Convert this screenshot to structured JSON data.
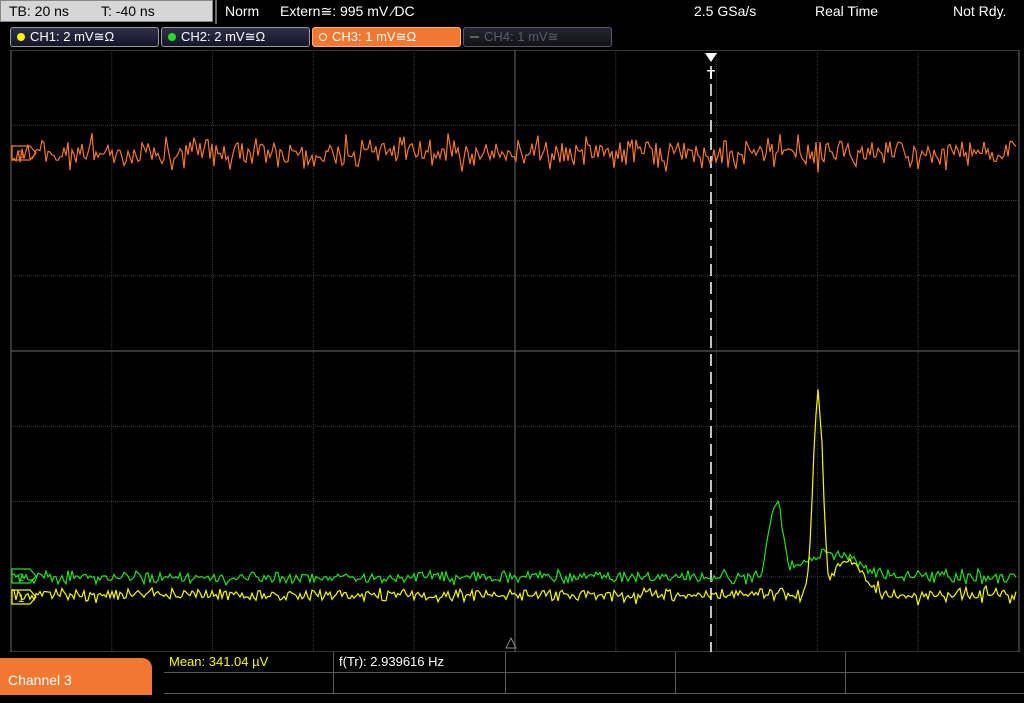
{
  "top": {
    "timebase": "TB: 20 ns",
    "trigger_time": "T: -40 ns",
    "mode": "Norm",
    "trigger_source": "Extern≅: 995 mV ⁄DC",
    "sample_rate": "2.5 GSa/s",
    "acq_mode": "Real Time",
    "status": "Not Rdy."
  },
  "channels": [
    {
      "label": "CH1: 2 mV≅Ω",
      "color": "#f7f700",
      "state": "on"
    },
    {
      "label": "CH2: 2 mV≅Ω",
      "color": "#22e022",
      "state": "on"
    },
    {
      "label": "CH3: 1 mV≅Ω",
      "color": "#f07830",
      "state": "active"
    },
    {
      "label": "CH4: 1 mV≅",
      "color": "#5d5d66",
      "state": "off"
    }
  ],
  "markers": {
    "trigger": "T",
    "ch3": "3",
    "ch2": "2",
    "ch1": "1"
  },
  "bottom": {
    "channel_tab": "Channel 3",
    "mean": "Mean: 341.04 µV",
    "freq": "f(Tr): 2.939616 Hz"
  },
  "colors": {
    "ch1": "#f7f700",
    "ch2": "#22e022",
    "ch3": "#f07830",
    "grid": "#3c3c3c",
    "axis": "#6a6a6a"
  }
}
